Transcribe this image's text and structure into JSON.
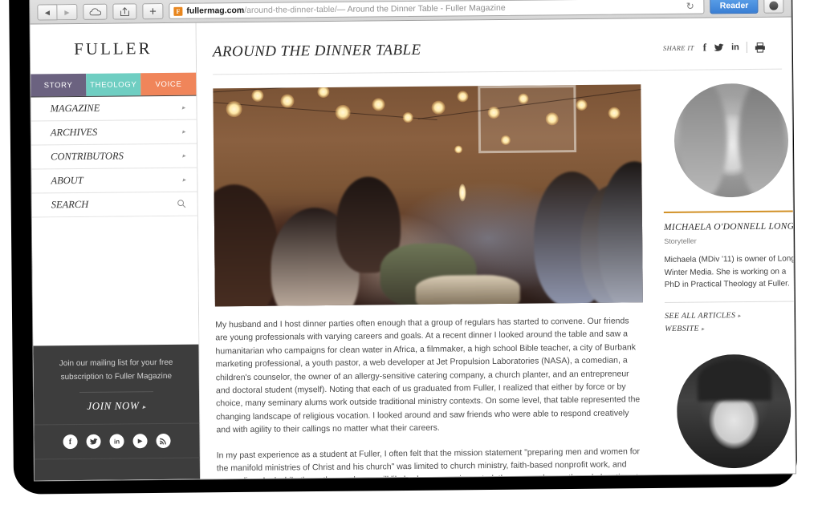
{
  "browser": {
    "back_label": "◀",
    "forward_label": "▶",
    "icloud_icon": "cloud-icon",
    "share_icon": "share-icon",
    "add_tab_label": "+",
    "favicon_letter": "F",
    "url_domain": "fullermag.com",
    "url_path": "/around-the-dinner-table/",
    "url_title": " — Around the Dinner Table - Fuller Magazine",
    "reload_label": "↻",
    "reader_label": "Reader",
    "downloads_icon": "downloads-icon"
  },
  "sidebar": {
    "logo": "FULLER",
    "tabs": [
      {
        "label": "STORY",
        "color": "#6b6280"
      },
      {
        "label": "THEOLOGY",
        "color": "#6fcec2"
      },
      {
        "label": "VOICE",
        "color": "#f0855a"
      }
    ],
    "nav_items": [
      {
        "label": "MAGAZINE",
        "marker": "▸"
      },
      {
        "label": "ARCHIVES",
        "marker": "▸"
      },
      {
        "label": "CONTRIBUTORS",
        "marker": "▸"
      },
      {
        "label": "ABOUT",
        "marker": "▸"
      },
      {
        "label": "SEARCH",
        "marker": "search-icon"
      }
    ],
    "footer": {
      "mailing_text": "Join our mailing list for your free subscription to Fuller Magazine",
      "join_label": "JOIN NOW",
      "join_arrow": "▸",
      "social": [
        {
          "name": "facebook",
          "glyph": "f"
        },
        {
          "name": "twitter",
          "glyph": "🐦"
        },
        {
          "name": "linkedin",
          "glyph": "in"
        },
        {
          "name": "youtube",
          "glyph": "▶"
        },
        {
          "name": "rss",
          "glyph": "❋"
        }
      ]
    }
  },
  "article": {
    "title": "AROUND THE DINNER TABLE",
    "share_label": "SHARE IT",
    "share_icons": [
      {
        "name": "facebook-share-icon",
        "glyph": "f"
      },
      {
        "name": "twitter-share-icon",
        "glyph": "🐦"
      },
      {
        "name": "linkedin-share-icon",
        "glyph": "in"
      },
      {
        "name": "print-icon",
        "glyph": "🖶"
      }
    ],
    "hero_alt": "Outdoor dinner party under string lights",
    "paragraph_1": "My husband and I host dinner parties often enough that a group of regulars has started to convene. Our friends are young professionals with varying careers and goals. At a recent dinner I looked around the table and saw a humanitarian who campaigns for clean water in Africa, a filmmaker, a high school Bible teacher, a city of Burbank marketing professional, a youth pastor, a web developer at Jet Propulsion Laboratories (NASA), a comedian, a children's counselor, the owner of an allergy-sensitive catering company, a church planter, and an entrepreneur and doctoral student (myself). Noting that each of us graduated from Fuller, I realized that either by force or by choice, many seminary alums work outside traditional ministry contexts. On some level, that table represented the changing landscape of religious vocation. I looked around and saw friends who were able to respond creatively and with agility to their callings no matter what their careers.",
    "paragraph_2": "In my past experience as a student at Fuller, I often felt that the mission statement \"preparing men and women for the manifold ministries of Christ and his church\" was limited to church ministry, faith-based nonprofit work, and counseling. And while these three spheres will likely always remain central, they are no longer the sole locations to which God is calling people to serve. Our dinner gatherings convinced me otherwise; our conversations often turn to updates on our work. Angela [PhD student], the youth pastor, asks"
  },
  "author": {
    "name": "MICHAELA O'DONNELL LONG",
    "role": "Storyteller",
    "bio": "Michaela (MDiv '11) is owner of Long Winter Media. She is working on a PhD in Practical Theology at Fuller.",
    "links": [
      {
        "label": "SEE ALL ARTICLES",
        "arrow": "▸"
      },
      {
        "label": "WEBSITE",
        "arrow": "▸"
      }
    ],
    "accent_color": "#d19025",
    "portrait_one_alt": "Portrait of Michaela O'Donnell Long",
    "portrait_two_alt": "Portrait of second contributor"
  }
}
